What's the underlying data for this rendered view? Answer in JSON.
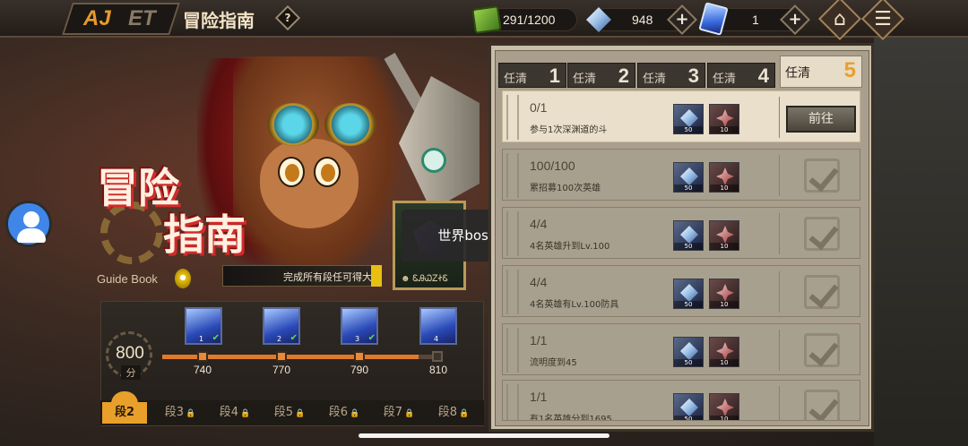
{
  "header": {
    "title": "冒险指南",
    "help": "?",
    "back_glyph_1": "AJ",
    "back_glyph_2": "ET",
    "stamina": "291/1200",
    "crystals": "948",
    "tickets": "1",
    "plus": "+"
  },
  "hero": {
    "title_line1": "冒险",
    "title_line2": "指南",
    "guide_book": "Guide Book",
    "hint": "完成所有段任可得大",
    "reward_label": "☻ ᏋᎯᏇᏃᏐᏋ"
  },
  "toast": "世界boss活未开",
  "milestones": {
    "score": "800",
    "score_unit": "分",
    "progress_fraction": 0.93,
    "nodes": [
      {
        "label": "740",
        "reached": true,
        "card_tag": "1",
        "claimed": true
      },
      {
        "label": "770",
        "reached": true,
        "card_tag": "2",
        "claimed": true
      },
      {
        "label": "790",
        "reached": true,
        "card_tag": "3",
        "claimed": true
      },
      {
        "label": "810",
        "reached": false,
        "card_tag": "4",
        "claimed": false
      }
    ],
    "check": "✔",
    "stages": [
      {
        "label": "段2",
        "active": true
      },
      {
        "label": "段3",
        "active": false
      },
      {
        "label": "段4",
        "active": false
      },
      {
        "label": "段5",
        "active": false
      },
      {
        "label": "段6",
        "active": false
      },
      {
        "label": "段7",
        "active": false
      },
      {
        "label": "段8",
        "active": false
      }
    ],
    "lock_icon": "🔒"
  },
  "quests": {
    "tabs": [
      {
        "label": "任清",
        "num": "1"
      },
      {
        "label": "任清",
        "num": "2"
      },
      {
        "label": "任清",
        "num": "3"
      },
      {
        "label": "任清",
        "num": "4"
      },
      {
        "label": "任清",
        "num": "5"
      }
    ],
    "reward_qty_crystal": "50",
    "reward_qty_gear": "10",
    "go_label": "前往",
    "rows": [
      {
        "progress": "0/1",
        "desc": "参与1次深渊道的斗",
        "done": false
      },
      {
        "progress": "100/100",
        "desc": "累招募100次英雄",
        "done": true
      },
      {
        "progress": "4/4",
        "desc": "4名英雄升到Lv.100",
        "done": true
      },
      {
        "progress": "4/4",
        "desc": "4名英雄有Lv.100防具",
        "done": true
      },
      {
        "progress": "1/1",
        "desc": "流明度到45",
        "done": true
      },
      {
        "progress": "1/1",
        "desc": "有1名英雄分到1695",
        "done": true
      }
    ]
  },
  "icons": {
    "home": "home-icon",
    "menu": "menu-icon",
    "avatar": "user-avatar-icon"
  },
  "colors": {
    "accent": "#e8a02a",
    "panel": "#c9bea8"
  }
}
